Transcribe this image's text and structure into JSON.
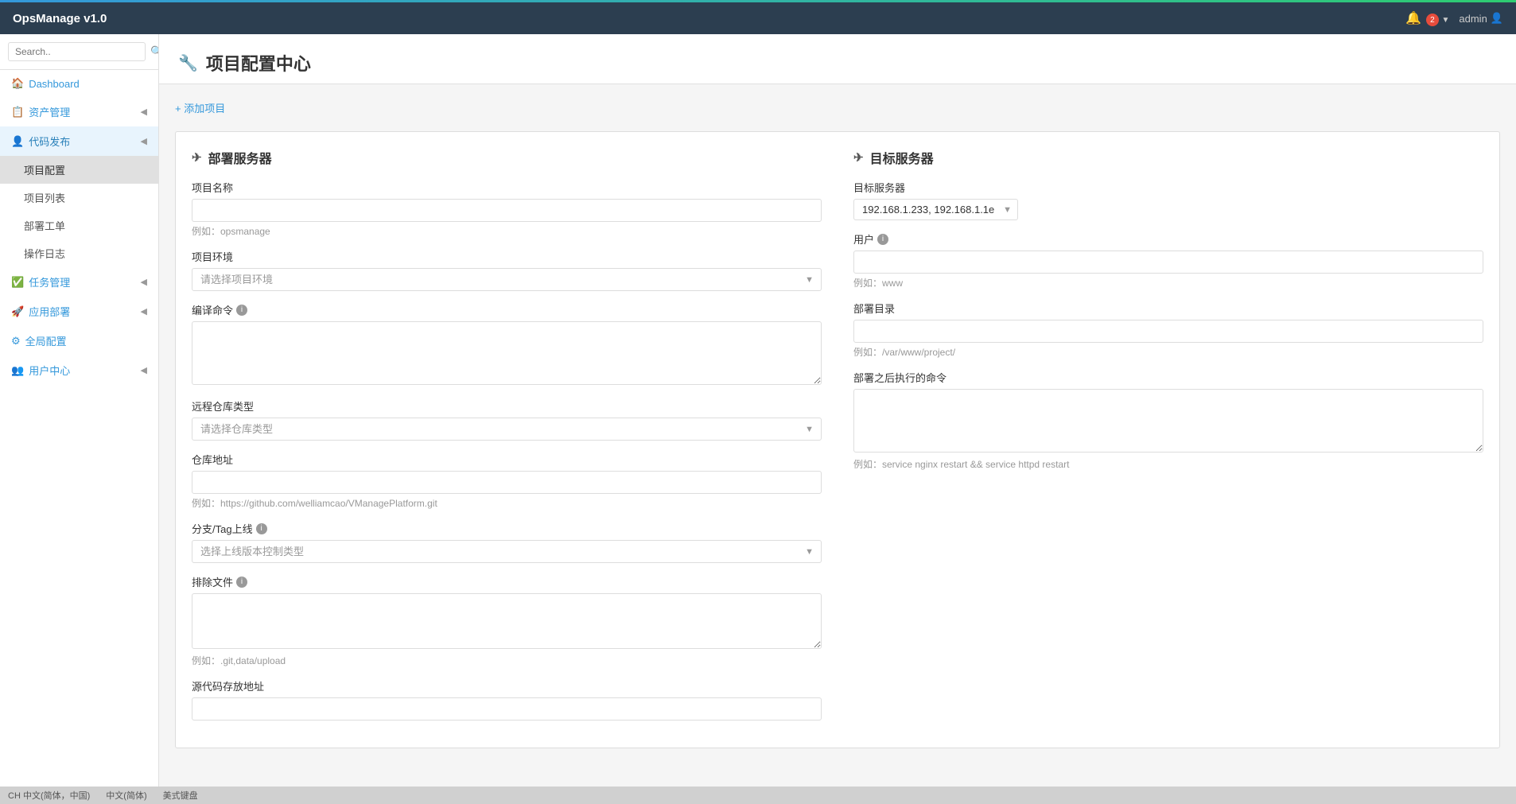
{
  "app": {
    "title": "OpsManage v1.0",
    "top_bar_color": "#3498db"
  },
  "navbar": {
    "brand": "OpsManage v1.0",
    "bell_count": "2",
    "user": "admin"
  },
  "sidebar": {
    "search_placeholder": "Search..",
    "items": [
      {
        "id": "dashboard",
        "label": "Dashboard",
        "icon": "🏠",
        "has_arrow": false,
        "active": false
      },
      {
        "id": "asset",
        "label": "资产管理",
        "icon": "📋",
        "has_arrow": true,
        "active": false
      },
      {
        "id": "deploy",
        "label": "代码发布",
        "icon": "👤",
        "has_arrow": true,
        "active": true,
        "children": [
          {
            "id": "project-config",
            "label": "项目配置",
            "active": true
          },
          {
            "id": "project-list",
            "label": "项目列表",
            "active": false
          },
          {
            "id": "deploy-task",
            "label": "部署工单",
            "active": false
          },
          {
            "id": "operation-log",
            "label": "操作日志",
            "active": false
          }
        ]
      },
      {
        "id": "task",
        "label": "任务管理",
        "icon": "✅",
        "has_arrow": true,
        "active": false
      },
      {
        "id": "app-deploy",
        "label": "应用部署",
        "icon": "🚀",
        "has_arrow": true,
        "active": false
      },
      {
        "id": "global-config",
        "label": "全局配置",
        "icon": "⚙",
        "has_arrow": false,
        "active": false
      },
      {
        "id": "user-center",
        "label": "用户中心",
        "icon": "👥",
        "has_arrow": true,
        "active": false
      }
    ]
  },
  "page": {
    "title": "项目配置中心",
    "icon": "🔧",
    "add_btn_label": "+ 添加项目"
  },
  "deploy_section": {
    "title": "部署服务器",
    "icon": "✈",
    "fields": {
      "project_name": {
        "label": "项目名称",
        "placeholder": "",
        "hint": "例如：opsmanage"
      },
      "project_env": {
        "label": "项目环境",
        "placeholder": "请选择项目环境",
        "hint": ""
      },
      "compile_cmd": {
        "label": "编译命令",
        "has_info": true,
        "placeholder": "",
        "hint": ""
      },
      "repo_type": {
        "label": "远程仓库类型",
        "placeholder": "请选择仓库类型",
        "hint": ""
      },
      "repo_url": {
        "label": "仓库地址",
        "placeholder": "",
        "hint": "例如：https://github.com/welliamcao/VManagePlatform.git"
      },
      "branch_tag": {
        "label": "分支/Tag上线",
        "has_info": true,
        "placeholder": "选择上线版本控制类型",
        "hint": ""
      },
      "exclude_files": {
        "label": "排除文件",
        "has_info": true,
        "placeholder": "",
        "hint": "例如：.git,data/upload"
      },
      "code_storage": {
        "label": "源代码存放地址",
        "placeholder": "",
        "hint": ""
      }
    }
  },
  "target_section": {
    "title": "目标服务器",
    "icon": "✈",
    "fields": {
      "target_server": {
        "label": "目标服务器",
        "value": "192.168.1.233, 192.168.1.1e"
      },
      "user": {
        "label": "用户",
        "has_info": true,
        "placeholder": "",
        "hint": "例如：www"
      },
      "deploy_dir": {
        "label": "部署目录",
        "placeholder": "",
        "hint": "例如：/var/www/project/"
      },
      "post_deploy_cmd": {
        "label": "部署之后执行的命令",
        "placeholder": "",
        "hint": "例如：service nginx restart && service httpd restart"
      }
    }
  },
  "statusbar": {
    "items": [
      {
        "label": "CH 中文(简体，中国)"
      },
      {
        "label": "中文(简体)"
      },
      {
        "label": "美式键盘"
      }
    ]
  }
}
